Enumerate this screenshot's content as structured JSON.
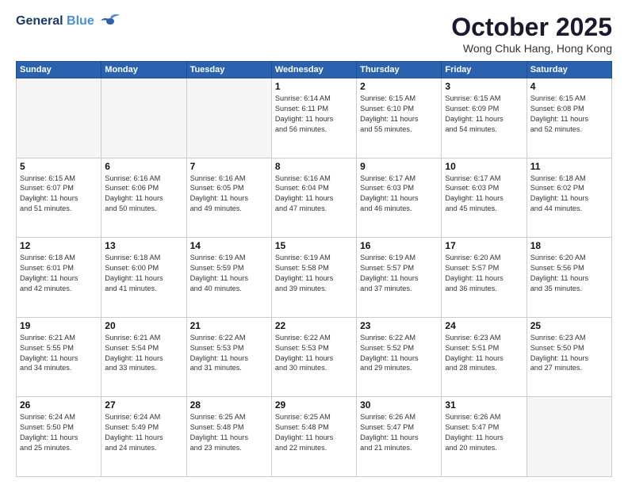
{
  "header": {
    "logo_line1": "General",
    "logo_line2": "Blue",
    "title": "October 2025",
    "subtitle": "Wong Chuk Hang, Hong Kong"
  },
  "weekdays": [
    "Sunday",
    "Monday",
    "Tuesday",
    "Wednesday",
    "Thursday",
    "Friday",
    "Saturday"
  ],
  "weeks": [
    [
      {
        "day": "",
        "info": ""
      },
      {
        "day": "",
        "info": ""
      },
      {
        "day": "",
        "info": ""
      },
      {
        "day": "1",
        "info": "Sunrise: 6:14 AM\nSunset: 6:11 PM\nDaylight: 11 hours\nand 56 minutes."
      },
      {
        "day": "2",
        "info": "Sunrise: 6:15 AM\nSunset: 6:10 PM\nDaylight: 11 hours\nand 55 minutes."
      },
      {
        "day": "3",
        "info": "Sunrise: 6:15 AM\nSunset: 6:09 PM\nDaylight: 11 hours\nand 54 minutes."
      },
      {
        "day": "4",
        "info": "Sunrise: 6:15 AM\nSunset: 6:08 PM\nDaylight: 11 hours\nand 52 minutes."
      }
    ],
    [
      {
        "day": "5",
        "info": "Sunrise: 6:15 AM\nSunset: 6:07 PM\nDaylight: 11 hours\nand 51 minutes."
      },
      {
        "day": "6",
        "info": "Sunrise: 6:16 AM\nSunset: 6:06 PM\nDaylight: 11 hours\nand 50 minutes."
      },
      {
        "day": "7",
        "info": "Sunrise: 6:16 AM\nSunset: 6:05 PM\nDaylight: 11 hours\nand 49 minutes."
      },
      {
        "day": "8",
        "info": "Sunrise: 6:16 AM\nSunset: 6:04 PM\nDaylight: 11 hours\nand 47 minutes."
      },
      {
        "day": "9",
        "info": "Sunrise: 6:17 AM\nSunset: 6:03 PM\nDaylight: 11 hours\nand 46 minutes."
      },
      {
        "day": "10",
        "info": "Sunrise: 6:17 AM\nSunset: 6:03 PM\nDaylight: 11 hours\nand 45 minutes."
      },
      {
        "day": "11",
        "info": "Sunrise: 6:18 AM\nSunset: 6:02 PM\nDaylight: 11 hours\nand 44 minutes."
      }
    ],
    [
      {
        "day": "12",
        "info": "Sunrise: 6:18 AM\nSunset: 6:01 PM\nDaylight: 11 hours\nand 42 minutes."
      },
      {
        "day": "13",
        "info": "Sunrise: 6:18 AM\nSunset: 6:00 PM\nDaylight: 11 hours\nand 41 minutes."
      },
      {
        "day": "14",
        "info": "Sunrise: 6:19 AM\nSunset: 5:59 PM\nDaylight: 11 hours\nand 40 minutes."
      },
      {
        "day": "15",
        "info": "Sunrise: 6:19 AM\nSunset: 5:58 PM\nDaylight: 11 hours\nand 39 minutes."
      },
      {
        "day": "16",
        "info": "Sunrise: 6:19 AM\nSunset: 5:57 PM\nDaylight: 11 hours\nand 37 minutes."
      },
      {
        "day": "17",
        "info": "Sunrise: 6:20 AM\nSunset: 5:57 PM\nDaylight: 11 hours\nand 36 minutes."
      },
      {
        "day": "18",
        "info": "Sunrise: 6:20 AM\nSunset: 5:56 PM\nDaylight: 11 hours\nand 35 minutes."
      }
    ],
    [
      {
        "day": "19",
        "info": "Sunrise: 6:21 AM\nSunset: 5:55 PM\nDaylight: 11 hours\nand 34 minutes."
      },
      {
        "day": "20",
        "info": "Sunrise: 6:21 AM\nSunset: 5:54 PM\nDaylight: 11 hours\nand 33 minutes."
      },
      {
        "day": "21",
        "info": "Sunrise: 6:22 AM\nSunset: 5:53 PM\nDaylight: 11 hours\nand 31 minutes."
      },
      {
        "day": "22",
        "info": "Sunrise: 6:22 AM\nSunset: 5:53 PM\nDaylight: 11 hours\nand 30 minutes."
      },
      {
        "day": "23",
        "info": "Sunrise: 6:22 AM\nSunset: 5:52 PM\nDaylight: 11 hours\nand 29 minutes."
      },
      {
        "day": "24",
        "info": "Sunrise: 6:23 AM\nSunset: 5:51 PM\nDaylight: 11 hours\nand 28 minutes."
      },
      {
        "day": "25",
        "info": "Sunrise: 6:23 AM\nSunset: 5:50 PM\nDaylight: 11 hours\nand 27 minutes."
      }
    ],
    [
      {
        "day": "26",
        "info": "Sunrise: 6:24 AM\nSunset: 5:50 PM\nDaylight: 11 hours\nand 25 minutes."
      },
      {
        "day": "27",
        "info": "Sunrise: 6:24 AM\nSunset: 5:49 PM\nDaylight: 11 hours\nand 24 minutes."
      },
      {
        "day": "28",
        "info": "Sunrise: 6:25 AM\nSunset: 5:48 PM\nDaylight: 11 hours\nand 23 minutes."
      },
      {
        "day": "29",
        "info": "Sunrise: 6:25 AM\nSunset: 5:48 PM\nDaylight: 11 hours\nand 22 minutes."
      },
      {
        "day": "30",
        "info": "Sunrise: 6:26 AM\nSunset: 5:47 PM\nDaylight: 11 hours\nand 21 minutes."
      },
      {
        "day": "31",
        "info": "Sunrise: 6:26 AM\nSunset: 5:47 PM\nDaylight: 11 hours\nand 20 minutes."
      },
      {
        "day": "",
        "info": ""
      }
    ]
  ]
}
